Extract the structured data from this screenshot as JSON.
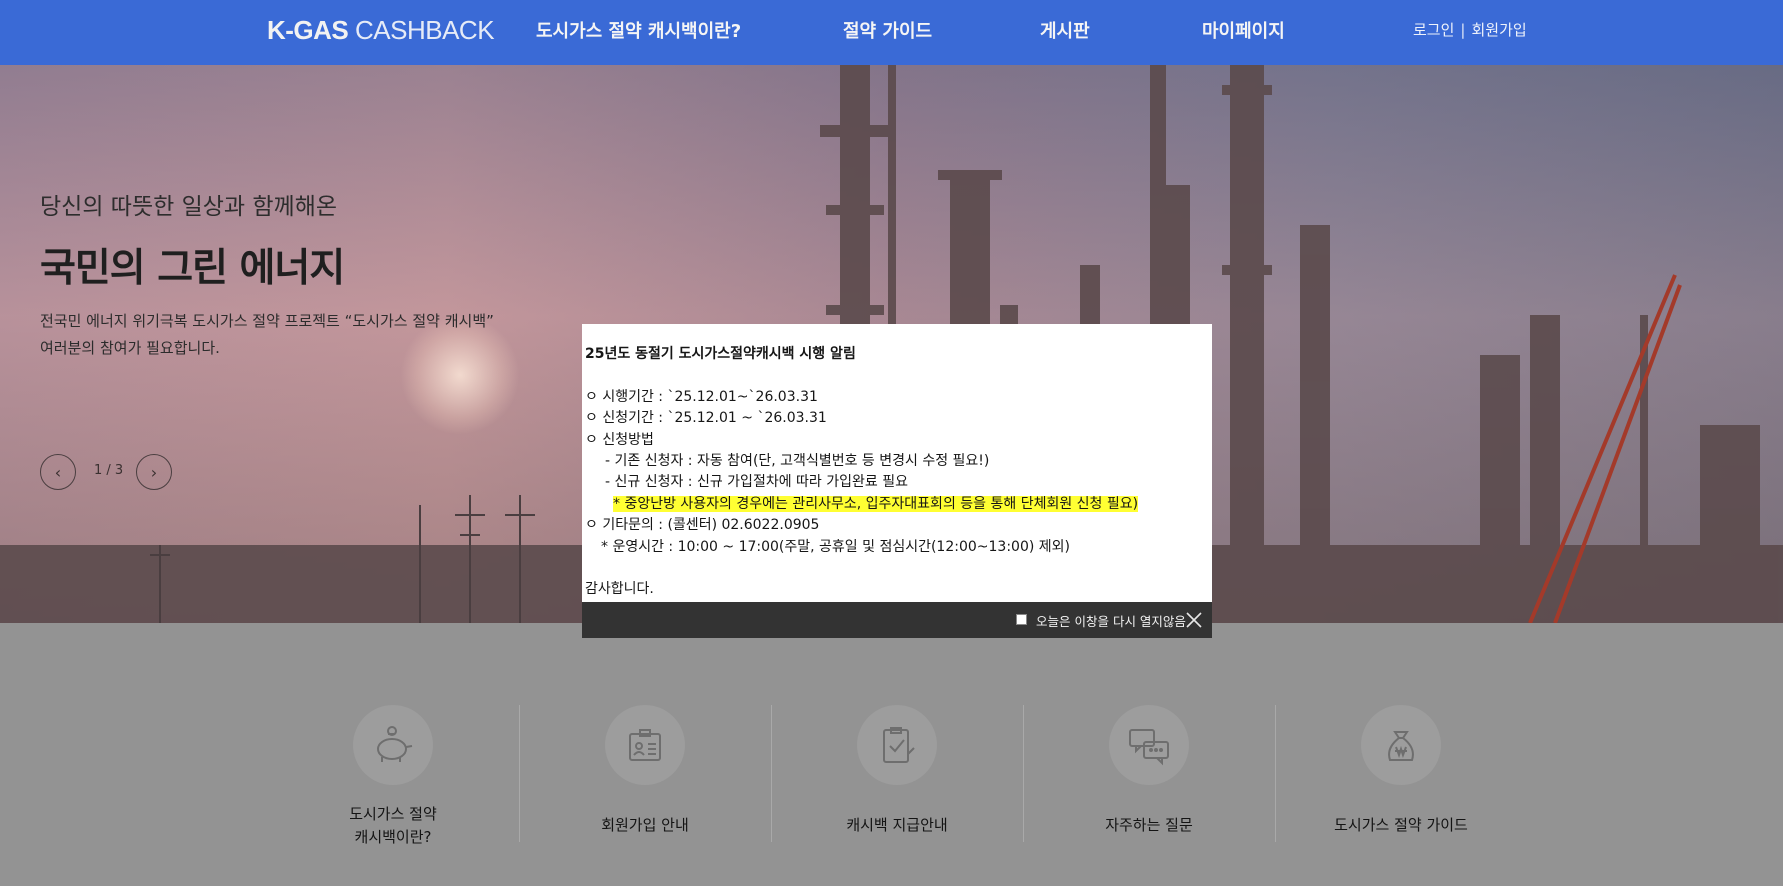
{
  "header": {
    "logo_bold": "K-GAS",
    "logo_light": " CASHBACK",
    "nav": [
      {
        "label": "도시가스 절약 캐시백이란?"
      },
      {
        "label": "절약 가이드"
      },
      {
        "label": "게시판"
      },
      {
        "label": "마이페이지"
      }
    ],
    "login": "로그인",
    "separator": "|",
    "signup": "회원가입"
  },
  "hero": {
    "subtitle": "당신의 따뜻한 일상과 함께해온",
    "title": "국민의 그린 에너지",
    "desc_line1": "전국민 에너지 위기극복 도시가스 절약 프로젝트 “도시가스 절약 캐시백”",
    "desc_line2": "여러분의 참여가 필요합니다.",
    "prev": "‹",
    "next": "›",
    "slide_counter": "1 / 3"
  },
  "quick_menu": [
    {
      "line1": "도시가스 절약",
      "line2": "캐시백이란?",
      "icon": "piggy-bank-icon"
    },
    {
      "line1": "회원가입 안내",
      "line2": "",
      "icon": "id-card-icon"
    },
    {
      "line1": "캐시백 지급안내",
      "line2": "",
      "icon": "clipboard-check-icon"
    },
    {
      "line1": "자주하는 질문",
      "line2": "",
      "icon": "chat-bubbles-icon"
    },
    {
      "line1": "도시가스 절약 가이드",
      "line2": "",
      "icon": "money-bag-icon"
    }
  ],
  "popup": {
    "title": "25년도 동절기 도시가스절약캐시백 시행 알림",
    "line_period": "ㅇ 시행기간 : `25.12.01~`26.03.31",
    "line_apply": "ㅇ 신청기간 : `25.12.01 ~ `26.03.31",
    "line_method": "ㅇ 신청방법",
    "line_existing": "- 기존 신청자 : 자동 참여(단, 고객식별번호 등 변경시 수정 필요!)",
    "line_new": "- 신규 신청자 : 신규 가입절차에 따라 가입완료 필요",
    "line_highlight": "* 중앙난방 사용자의 경우에는 관리사무소, 입주자대표회의 등을 통해 단체회원 신청 필요)",
    "line_contact": "ㅇ 기타문의 : (콜센터) 02.6022.0905",
    "line_hours": "* 운영시간 : 10:00 ~ 17:00(주말, 공휴일 및 점심시간(12:00~13:00) 제외)",
    "thanks": "감사합니다.",
    "dont_show_today": "오늘은 이창을 다시 열지않음"
  },
  "colors": {
    "header_bg": "#3a6ad6",
    "highlight": "#ffff33",
    "popup_footer": "#333333"
  }
}
